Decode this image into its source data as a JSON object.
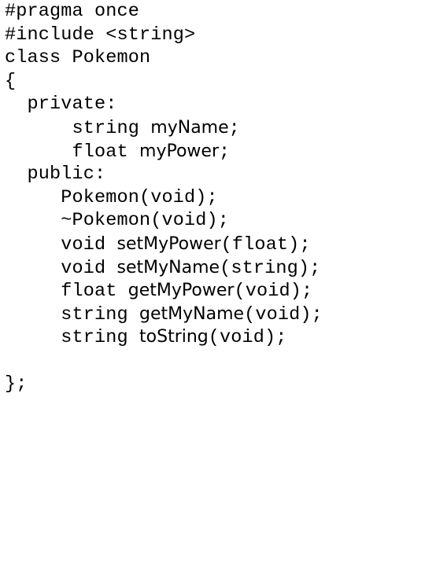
{
  "document": {
    "kind": "source-code-listing",
    "language": "C++",
    "title": "Pokemon.h",
    "background_color": "#ffffff",
    "text_color": "#000000"
  },
  "code": {
    "lines": [
      {
        "id": "line-1",
        "indent": "",
        "text": "#pragma once",
        "segments": [
          {
            "font": "mono",
            "text": "#pragma once"
          }
        ]
      },
      {
        "id": "line-2",
        "indent": "",
        "text": "#include <string>",
        "segments": [
          {
            "font": "mono",
            "text": "#include <string>"
          }
        ]
      },
      {
        "id": "line-3",
        "indent": "",
        "text": "class Pokemon",
        "segments": [
          {
            "font": "mono",
            "text": "class Pokemon"
          }
        ]
      },
      {
        "id": "line-4",
        "indent": "",
        "text": "{",
        "segments": [
          {
            "font": "mono",
            "text": "{"
          }
        ]
      },
      {
        "id": "line-5",
        "indent": "  ",
        "text": "  private:",
        "segments": [
          {
            "font": "mono",
            "text": "  private:"
          }
        ]
      },
      {
        "id": "line-6",
        "indent": "      ",
        "text": "      string myName;",
        "segments": [
          {
            "font": "mono",
            "text": "      string "
          },
          {
            "font": "alt",
            "text": "myName"
          },
          {
            "font": "mono",
            "text": ";"
          }
        ]
      },
      {
        "id": "line-7",
        "indent": "      ",
        "text": "      float myPower;",
        "segments": [
          {
            "font": "mono",
            "text": "      float "
          },
          {
            "font": "alt",
            "text": "myPower"
          },
          {
            "font": "mono",
            "text": ";"
          }
        ]
      },
      {
        "id": "line-8",
        "indent": "  ",
        "text": "  public:",
        "segments": [
          {
            "font": "mono",
            "text": "  public:"
          }
        ]
      },
      {
        "id": "line-9",
        "indent": "     ",
        "text": "     Pokemon(void);",
        "segments": [
          {
            "font": "mono",
            "text": "     Pokemon(void);"
          }
        ]
      },
      {
        "id": "line-10",
        "indent": "     ",
        "text": "     ~Pokemon(void);",
        "segments": [
          {
            "font": "mono",
            "text": "     ~Pokemon(void);"
          }
        ]
      },
      {
        "id": "line-11",
        "indent": "     ",
        "text": "     void setMyPower(float);",
        "segments": [
          {
            "font": "mono",
            "text": "     void "
          },
          {
            "font": "alt",
            "text": "setMyPower"
          },
          {
            "font": "mono",
            "text": "(float);"
          }
        ]
      },
      {
        "id": "line-12",
        "indent": "     ",
        "text": "     void setMyName(string);",
        "segments": [
          {
            "font": "mono",
            "text": "     void "
          },
          {
            "font": "alt",
            "text": "setMyName"
          },
          {
            "font": "mono",
            "text": "(string);"
          }
        ]
      },
      {
        "id": "line-13",
        "indent": "     ",
        "text": "     float getMyPower(void);",
        "segments": [
          {
            "font": "mono",
            "text": "     float "
          },
          {
            "font": "alt",
            "text": "getMyPower"
          },
          {
            "font": "mono",
            "text": "(void);"
          }
        ]
      },
      {
        "id": "line-14",
        "indent": "     ",
        "text": "     string getMyName(void);",
        "segments": [
          {
            "font": "mono",
            "text": "     string "
          },
          {
            "font": "alt",
            "text": "getMyName"
          },
          {
            "font": "mono",
            "text": "(void);"
          }
        ]
      },
      {
        "id": "line-15",
        "indent": "     ",
        "text": "     string toString(void);",
        "segments": [
          {
            "font": "mono",
            "text": "     string "
          },
          {
            "font": "alt",
            "text": "toString"
          },
          {
            "font": "mono",
            "text": "(void);"
          }
        ]
      },
      {
        "id": "line-16",
        "indent": "",
        "text": "",
        "segments": []
      },
      {
        "id": "line-17",
        "indent": "",
        "text": "};",
        "segments": [
          {
            "font": "mono",
            "text": "};"
          }
        ]
      }
    ]
  }
}
